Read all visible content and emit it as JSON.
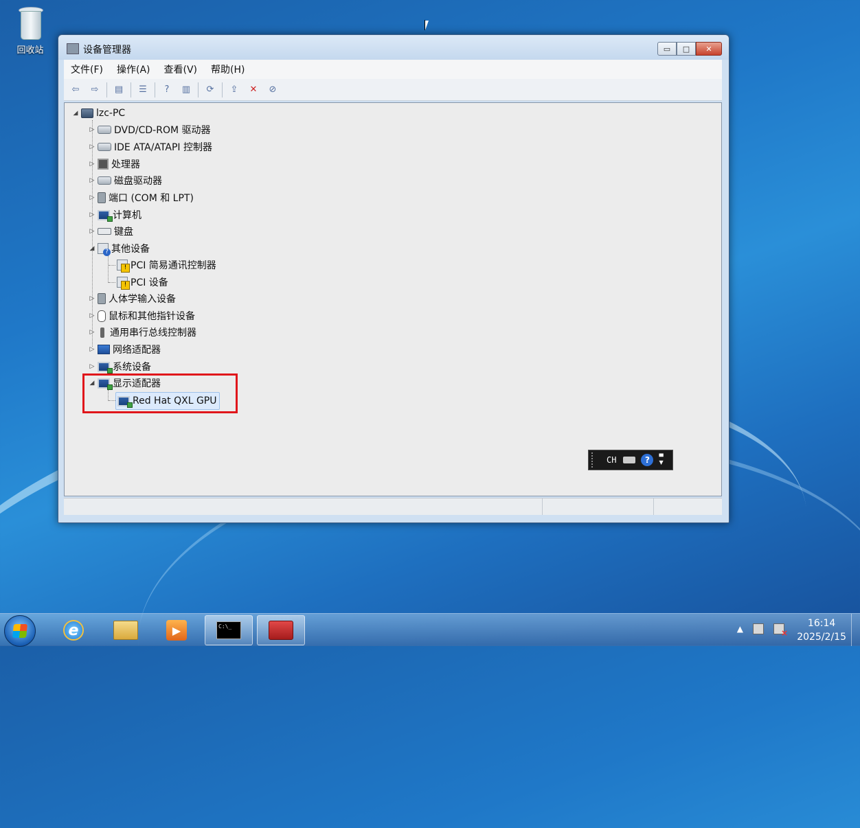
{
  "desktop": {
    "recycle_bin_label": "回收站"
  },
  "window": {
    "title": "设备管理器",
    "minimize_glyph": "▭",
    "maximize_glyph": "□",
    "close_glyph": "✕"
  },
  "menubar": {
    "items": [
      "文件(F)",
      "操作(A)",
      "查看(V)",
      "帮助(H)"
    ]
  },
  "toolbar": {
    "back_glyph": "⇦",
    "forward_glyph": "⇨",
    "console_tree_glyph": "▤",
    "properties_glyph": "☰",
    "help_glyph": "?",
    "view_glyph": "▥",
    "scan_glyph": "⟳",
    "update_glyph": "⇪",
    "uninstall_glyph": "✕",
    "disable_glyph": "⊘"
  },
  "tree": {
    "root": "lzc-PC",
    "categories": {
      "dvd": "DVD/CD-ROM 驱动器",
      "ide": "IDE ATA/ATAPI 控制器",
      "cpu": "处理器",
      "disk": "磁盘驱动器",
      "ports": "端口 (COM 和 LPT)",
      "computer": "计算机",
      "keyboard": "键盘",
      "other": "其他设备",
      "other_child_1": "PCI 简易通讯控制器",
      "other_child_2": "PCI 设备",
      "hid": "人体学输入设备",
      "mouse": "鼠标和其他指针设备",
      "usb": "通用串行总线控制器",
      "network": "网络适配器",
      "system": "系统设备",
      "display": "显示适配器",
      "display_child": "Red Hat QXL GPU"
    },
    "expanded_glyph": "◢",
    "collapsed_glyph": "▷"
  },
  "langbar": {
    "language": "CH",
    "help_glyph": "?"
  },
  "taskbar": {
    "ie_glyph": "e",
    "media_glyph": "▶",
    "cmd_text": "C:\\_",
    "clock_time": "16:14",
    "clock_date": "2025/2/15",
    "tray_arrow": "▲"
  },
  "colors": {
    "highlight_border": "#e0161b",
    "selection_bg": "#dceafc"
  }
}
